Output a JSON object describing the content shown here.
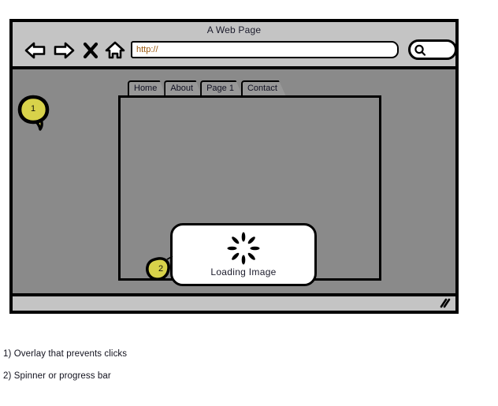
{
  "window": {
    "title": "A Web Page",
    "chrome_color": "#c4c4c4",
    "page_color": "#8a8a8a",
    "border_color": "#000000"
  },
  "toolbar": {
    "back_icon": "back-arrow-icon",
    "forward_icon": "forward-arrow-icon",
    "stop_icon": "stop-x-icon",
    "home_icon": "home-house-icon",
    "url_value": "http://",
    "url_placeholder": "http://",
    "url_text_color": "#9c5a10",
    "search_icon": "search-icon"
  },
  "tabs": [
    {
      "label": "Home"
    },
    {
      "label": "About"
    },
    {
      "label": "Page 1"
    },
    {
      "label": "Contact"
    }
  ],
  "dialog": {
    "label": "Loading Image",
    "spinner_icon": "spinner-icon",
    "spinner_petals": 8,
    "background": "#ffffff"
  },
  "status_bar": {
    "resize_icon": "resize-grip-icon"
  },
  "markers": [
    {
      "number": "1",
      "color": "#d8d24a"
    },
    {
      "number": "2",
      "color": "#d8d24a"
    }
  ],
  "captions": [
    {
      "text": "1) Overlay that prevents clicks"
    },
    {
      "text": "2) Spinner or progress bar"
    }
  ]
}
